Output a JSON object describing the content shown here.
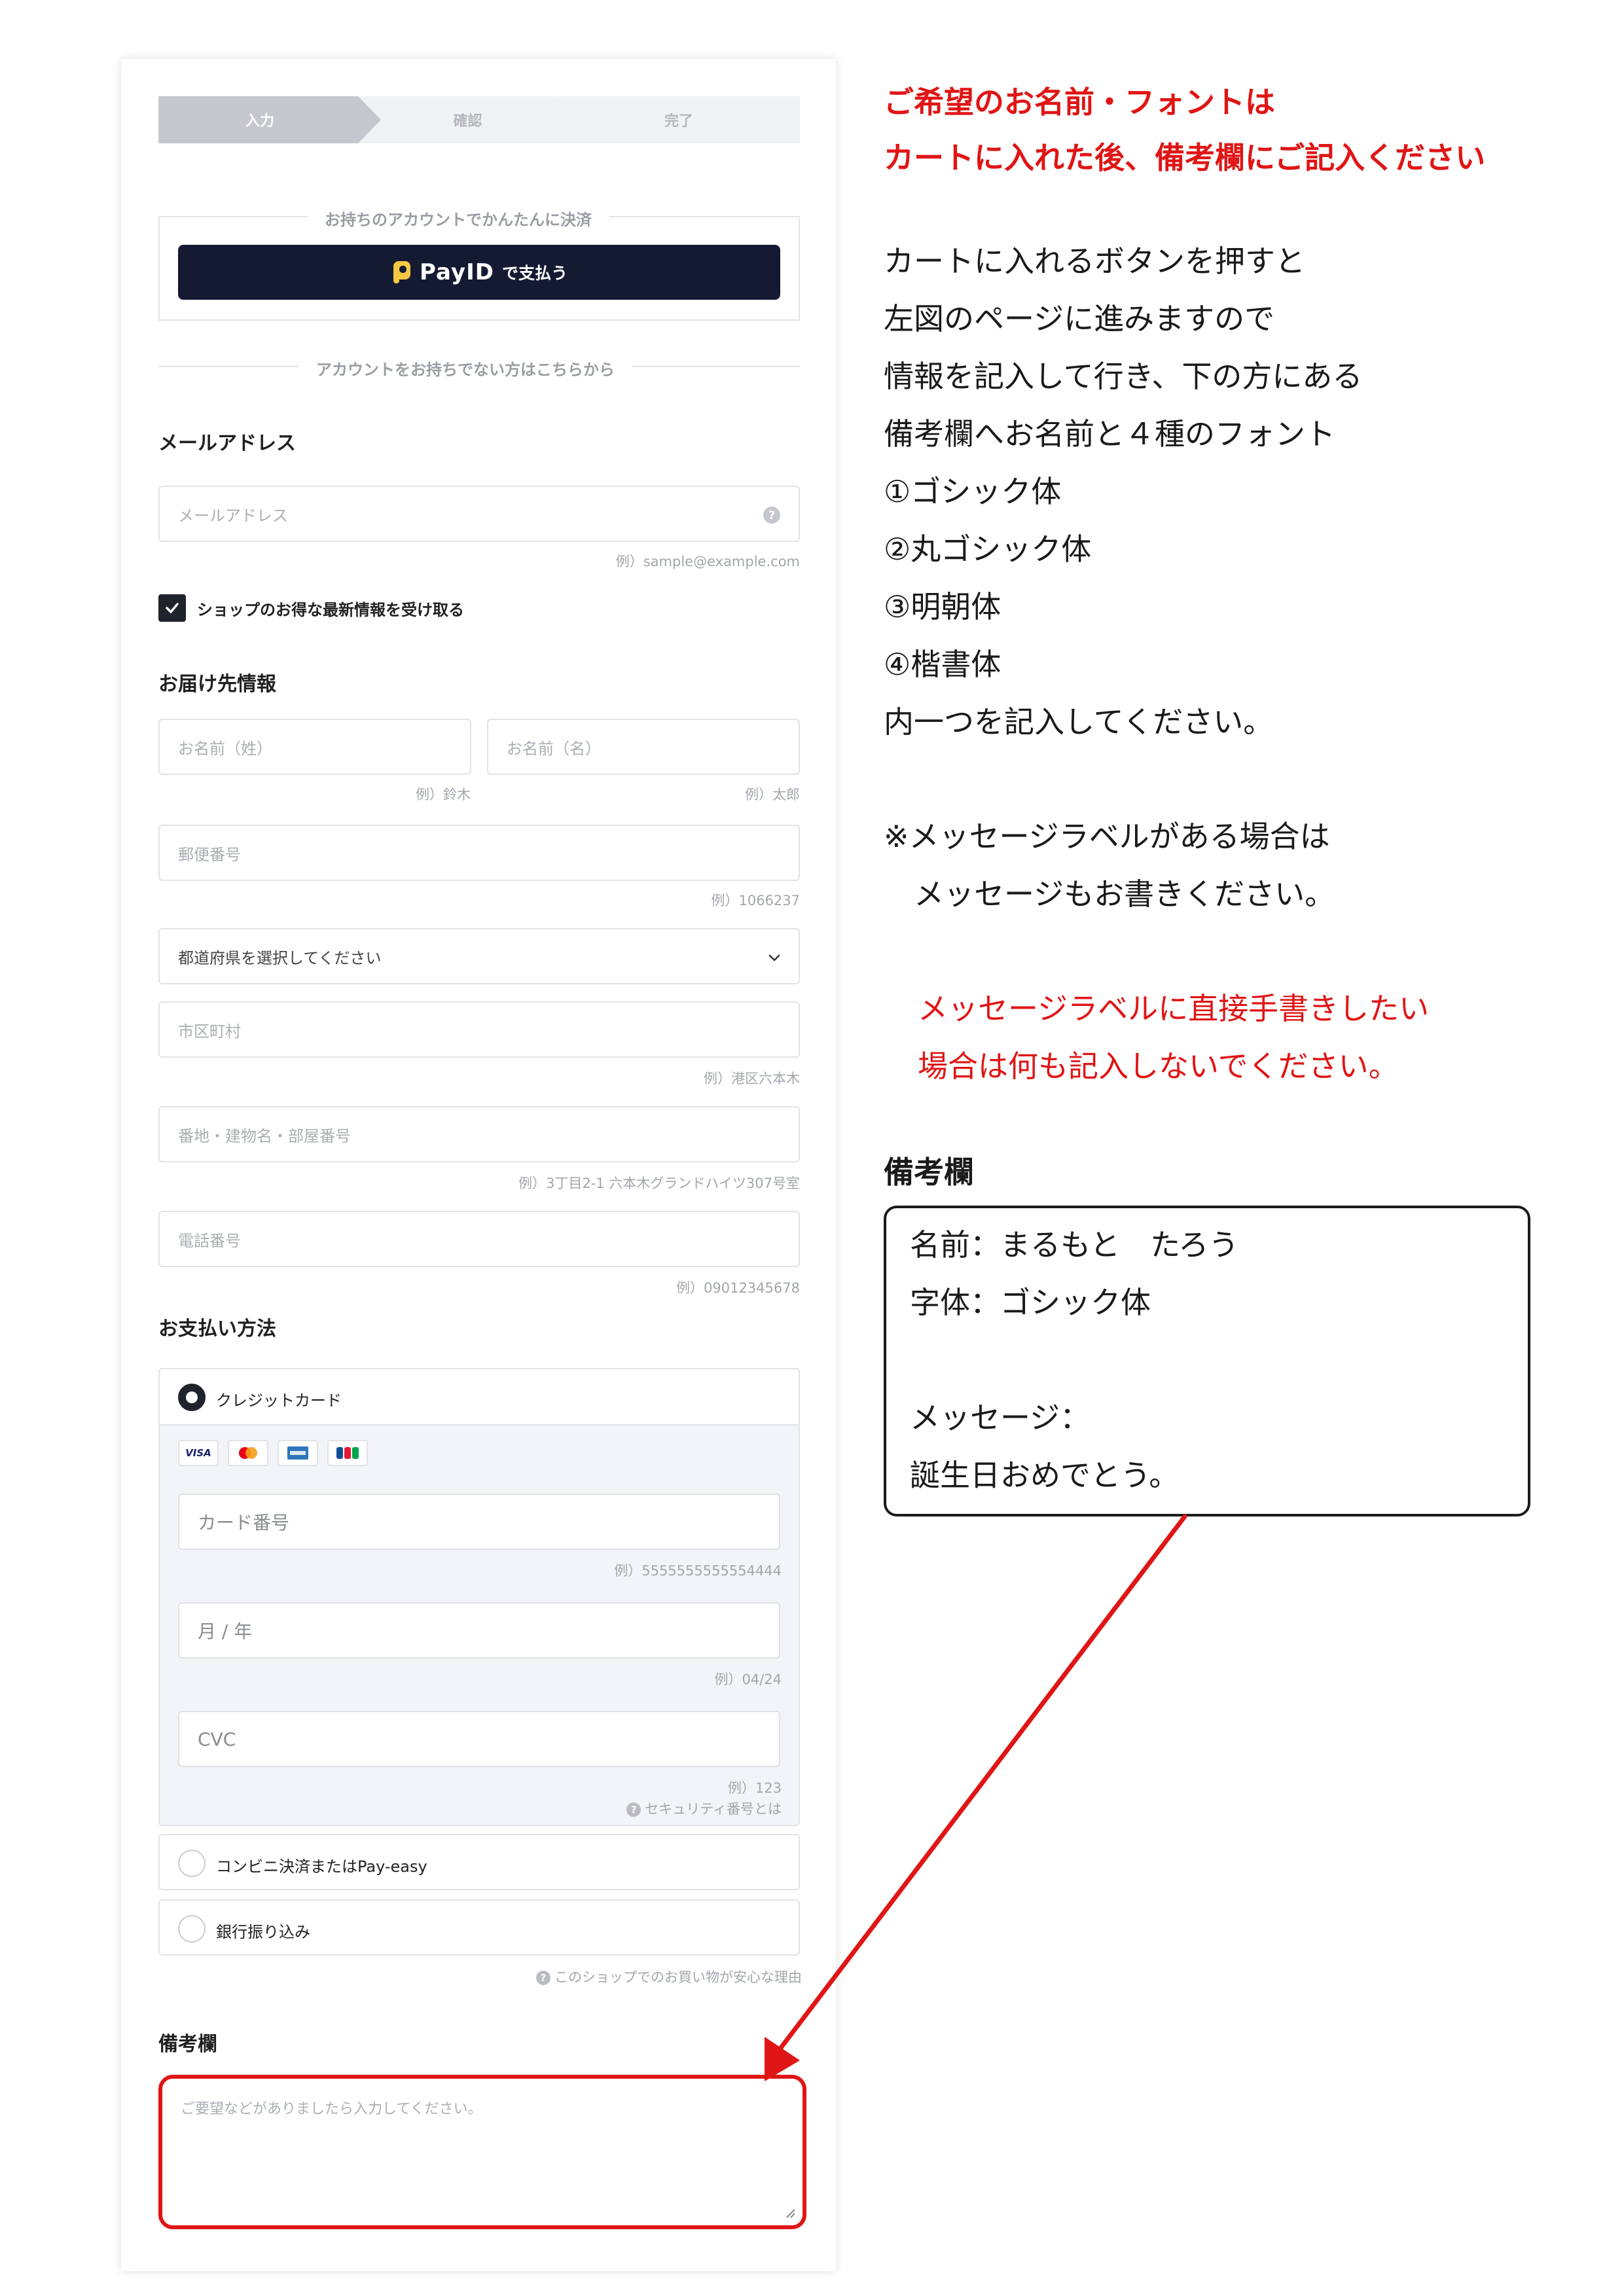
{
  "stepper": {
    "steps": [
      "入力",
      "確認",
      "完了"
    ]
  },
  "payid": {
    "legend": "お持ちのアカウントでかんたんに決済",
    "brand": "PayID",
    "button_suffix": "で支払う"
  },
  "guest_divider": "アカウントをお持ちでない方はこちらから",
  "email": {
    "title": "メールアドレス",
    "placeholder": "メールアドレス",
    "hint": "例）sample@example.com",
    "help_glyph": "?"
  },
  "newsletter": {
    "label": "ショップのお得な最新情報を受け取る",
    "checked": true
  },
  "shipping": {
    "title": "お届け先情報",
    "last_name_placeholder": "お名前（姓）",
    "last_name_hint": "例）鈴木",
    "first_name_placeholder": "お名前（名）",
    "first_name_hint": "例）太郎",
    "postal_placeholder": "郵便番号",
    "postal_hint": "例）1066237",
    "prefecture_selected": "都道府県を選択してください",
    "city_placeholder": "市区町村",
    "city_hint": "例）港区六本木",
    "address_placeholder": "番地・建物名・部屋番号",
    "address_hint": "例）3丁目2-1 六本木グランドハイツ307号室",
    "phone_placeholder": "電話番号",
    "phone_hint": "例）09012345678"
  },
  "payment": {
    "title": "お支払い方法",
    "credit_label": "クレジットカード",
    "card_brands": [
      "VISA",
      "mastercard",
      "amex",
      "JCB"
    ],
    "card_number_placeholder": "カード番号",
    "card_number_hint": "例）5555555555554444",
    "expiry_placeholder": "月 / 年",
    "expiry_hint": "例）04/24",
    "cvc_placeholder": "CVC",
    "cvc_hint": "例）123",
    "security_link": "セキュリティ番号とは",
    "info_glyph": "?",
    "konbini_label": "コンビニ決済またはPay-easy",
    "bank_label": "銀行振り込み",
    "safety_link": "このショップでのお買い物が安心な理由"
  },
  "remarks": {
    "title": "備考欄",
    "placeholder": "ご要望などがありましたら入力してください。"
  },
  "instructions": {
    "heading_lines": [
      "ご希望のお名前・フォントは",
      "カートに入れた後、備考欄にご記入ください"
    ],
    "body_lines": [
      "カートに入れるボタンを押すと",
      "左図のページに進みますので",
      "情報を記入して行き、下の方にある",
      "備考欄へお名前と４種のフォント",
      "①ゴシック体",
      "②丸ゴシック体",
      "③明朝体",
      "④楷書体",
      "内一つを記入してください。"
    ],
    "message_note_lines": [
      "※メッセージラベルがある場合は",
      "　メッセージもお書きください。"
    ],
    "red_note_lines": [
      "メッセージラベルに直接手書きしたい",
      "場合は何も記入しないでください。"
    ],
    "memo_title": "備考欄",
    "example_lines": [
      "名前：まるもと　たろう",
      "字体：ゴシック体",
      "",
      "メッセージ：",
      "誕生日おめでとう。"
    ]
  },
  "colors": {
    "accent_red": "#e01515",
    "payid_navy": "#151a33",
    "step_active": "#c4c8ce"
  }
}
